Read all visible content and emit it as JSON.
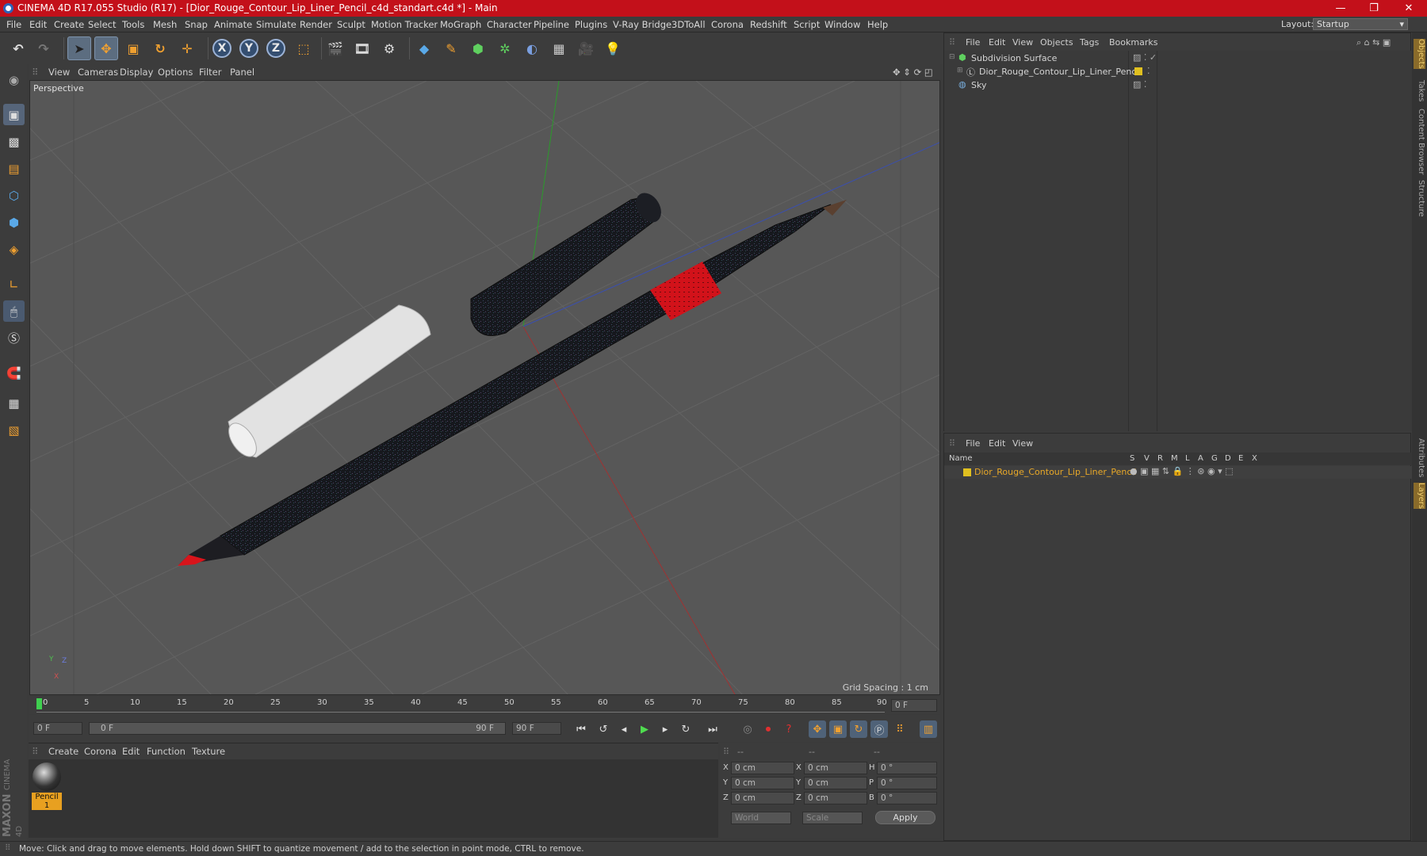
{
  "window": {
    "title": "CINEMA 4D R17.055 Studio (R17) - [Dior_Rouge_Contour_Lip_Liner_Pencil_c4d_standart.c4d *] - Main",
    "minimize": "—",
    "maximize": "❐",
    "close": "✕"
  },
  "menubar": {
    "items": [
      "File",
      "Edit",
      "Create",
      "Select",
      "Tools",
      "Mesh",
      "Snap",
      "Animate",
      "Simulate",
      "Render",
      "Sculpt",
      "Motion Tracker",
      "MoGraph",
      "Character",
      "Pipeline",
      "Plugins",
      "V-Ray Bridge",
      "3DToAll",
      "Corona",
      "Redshift",
      "Script",
      "Window",
      "Help"
    ],
    "layout_label": "Layout:",
    "layout_value": "Startup"
  },
  "toolbar": {
    "axis_x": "X",
    "axis_y": "Y",
    "axis_z": "Z"
  },
  "viewport": {
    "menu": [
      "View",
      "Cameras",
      "Display",
      "Options",
      "Filter",
      "Panel"
    ],
    "label": "Perspective",
    "grid_spacing": "Grid Spacing : 1 cm",
    "axis_y": "Y",
    "axis_z": "Z",
    "axis_x": "X"
  },
  "timeline": {
    "ticks": [
      "0",
      "5",
      "10",
      "15",
      "20",
      "25",
      "30",
      "35",
      "40",
      "45",
      "50",
      "55",
      "60",
      "65",
      "70",
      "75",
      "80",
      "85",
      "90"
    ],
    "current_frame": "0 F"
  },
  "controls": {
    "start_frame": "0 F",
    "range_start": "0 F",
    "range_end": "90 F",
    "end_frame": "90 F"
  },
  "material_manager": {
    "menu": [
      "Create",
      "Corona",
      "Edit",
      "Function",
      "Texture"
    ],
    "materials": [
      {
        "name": "Pencil 1"
      }
    ],
    "brand_line1": "MAXON",
    "brand_line2": "CINEMA 4D"
  },
  "coordinates": {
    "header": [
      "--",
      "--",
      "--"
    ],
    "rows": [
      {
        "l1": "X",
        "v1": "0 cm",
        "l2": "X",
        "v2": "0 cm",
        "l3": "H",
        "v3": "0 °"
      },
      {
        "l1": "Y",
        "v1": "0 cm",
        "l2": "Y",
        "v2": "0 cm",
        "l3": "P",
        "v3": "0 °"
      },
      {
        "l1": "Z",
        "v1": "0 cm",
        "l2": "Z",
        "v2": "0 cm",
        "l3": "B",
        "v3": "0 °"
      }
    ],
    "space_select": "World",
    "mode_select": "Scale",
    "apply": "Apply"
  },
  "object_manager": {
    "menu": [
      "File",
      "Edit",
      "View",
      "Objects",
      "Tags",
      "Bookmarks"
    ],
    "objects": [
      {
        "name": "Subdivision Surface",
        "indent": 0
      },
      {
        "name": "Dior_Rouge_Contour_Lip_Liner_Pencil",
        "indent": 1
      },
      {
        "name": "Sky",
        "indent": 0
      }
    ]
  },
  "layer_manager": {
    "menu": [
      "File",
      "Edit",
      "View"
    ],
    "columns": [
      "Name",
      "S",
      "V",
      "R",
      "M",
      "L",
      "A",
      "G",
      "D",
      "E",
      "X"
    ],
    "layers": [
      {
        "name": "Dior_Rouge_Contour_Lip_Liner_Pencil",
        "color": "#e0c020"
      }
    ]
  },
  "right_tabs": [
    "Objects",
    "Takes",
    "Content Browser",
    "Structure",
    "Attributes",
    "Layers"
  ],
  "status": "Move: Click and drag to move elements. Hold down SHIFT to quantize movement / add to the selection in point mode, CTRL to remove.",
  "colors": {
    "titlebar": "#c3101a",
    "accent_orange": "#f0a030",
    "selected_layer": "#e0b030"
  }
}
